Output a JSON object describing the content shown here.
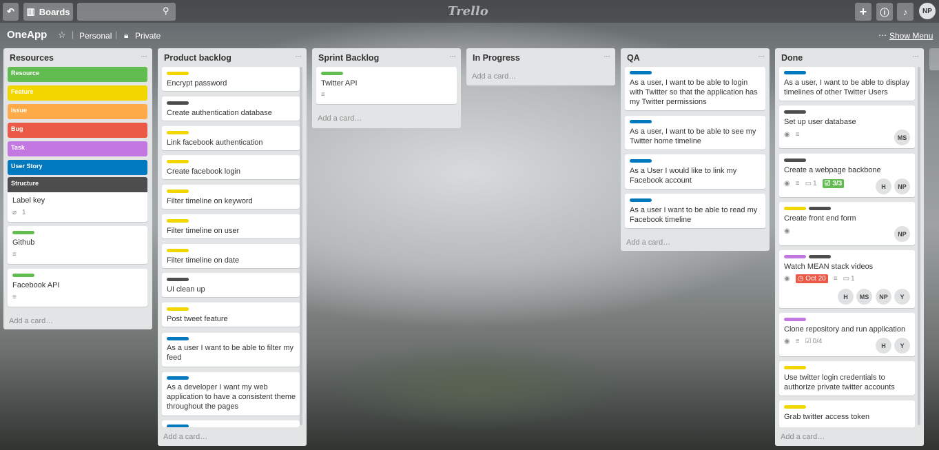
{
  "topbar": {
    "boards": "Boards",
    "logo": "Trello",
    "avatar": "NP"
  },
  "board": {
    "title": "OneApp",
    "team": "Personal",
    "visibility": "Private",
    "menu": "Show Menu"
  },
  "add_card": "Add a card…",
  "lists": {
    "resources": {
      "title": "Resources",
      "labels": [
        "Resource",
        "Feature",
        "Issue",
        "Bug",
        "Task",
        "User Story",
        "Structure"
      ],
      "colors": [
        "#61bd4f",
        "#f2d600",
        "#ffab4a",
        "#eb5a46",
        "#c377e0",
        "#0079bf",
        "#4d4d4d"
      ],
      "cards": [
        {
          "text": "Label key",
          "attach": "1"
        },
        {
          "text": "Github"
        },
        {
          "text": "Facebook API"
        }
      ]
    },
    "product": {
      "title": "Product backlog",
      "cards": [
        "Encrypt password",
        "Create authentication database",
        "Link facebook authentication",
        "Create facebook login",
        "Filter timeline on keyword",
        "Filter timeline on user",
        "Filter timeline on date",
        "UI clean up",
        "Post tweet feature",
        "As a user I want to be able to filter my feed",
        "As a developer I want my web application to have a consistent theme throughout the pages"
      ]
    },
    "sprint": {
      "title": "Sprint Backlog",
      "cards": [
        "Twitter API"
      ]
    },
    "progress": {
      "title": "In Progress"
    },
    "qa": {
      "title": "QA",
      "cards": [
        "As a user, I want to be able to login with Twitter so that the application has my Twitter permissions",
        "As a user, I want to be able to see my Twitter home timeline",
        "As a User I would like to link my Facebook account",
        "As a user I want to be able to read my Facebook timeline"
      ]
    },
    "done": {
      "title": "Done",
      "cards": [
        "As a user, I want to be able to display timelines of other Twitter Users",
        "Set up user database",
        "Create a webpage backbone",
        "Create front end form",
        "Watch MEAN stack videos",
        "Clone repository and run application",
        "Use twitter login credentials to authorize private twitter accounts",
        "Grab twitter access token"
      ],
      "badges": {
        "comments1": "1",
        "checklist1": "3/3",
        "due": "Oct 20",
        "comments2": "1",
        "checklist2": "0/4"
      },
      "members": {
        "ms": "MS",
        "h": "H",
        "np": "NP",
        "y": "Y"
      }
    }
  }
}
